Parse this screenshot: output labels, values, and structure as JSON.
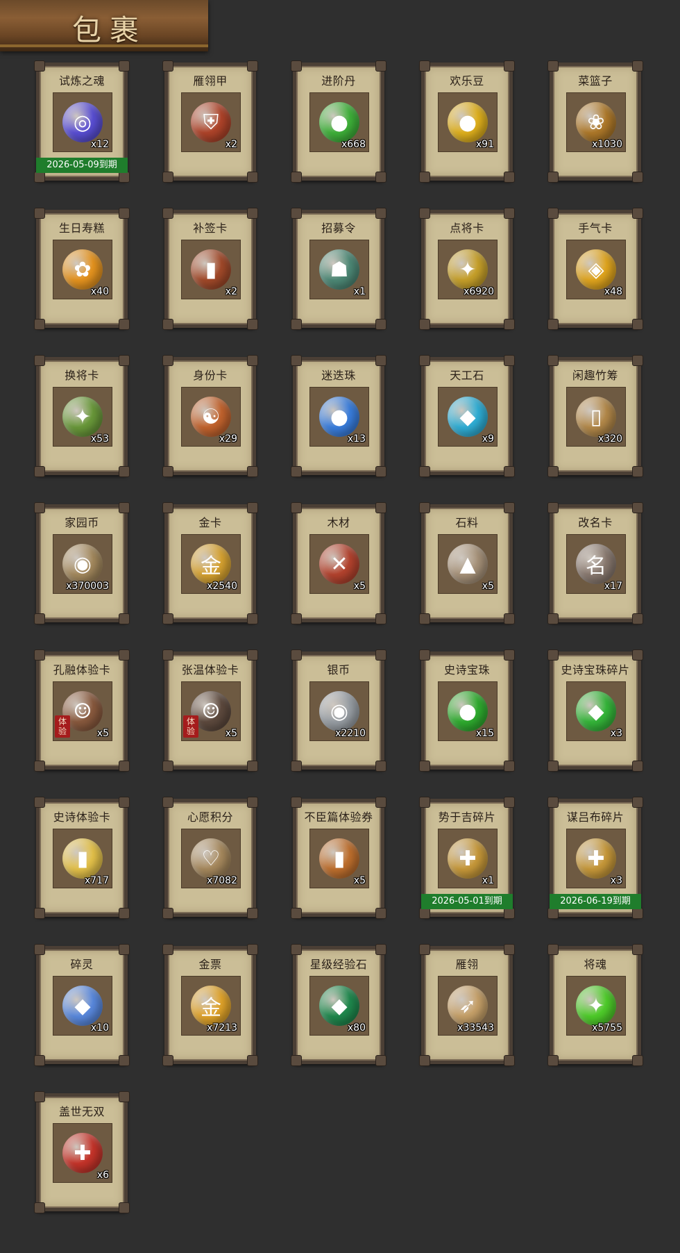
{
  "header": {
    "title": "包裹"
  },
  "items": [
    {
      "name": "试炼之魂",
      "qty": "x12",
      "icon": "dragon-orb-icon",
      "color": "#5a4fd6",
      "glyph": "◎",
      "expiry": "2026-05-09到期"
    },
    {
      "name": "雁翎甲",
      "qty": "x2",
      "icon": "armor-icon",
      "color": "#b0442a",
      "glyph": "⛨",
      "expiry": ""
    },
    {
      "name": "进阶丹",
      "qty": "x668",
      "icon": "pill-icon",
      "color": "#3fb33a",
      "glyph": "●",
      "expiry": ""
    },
    {
      "name": "欢乐豆",
      "qty": "x91",
      "icon": "beans-icon",
      "color": "#e2b21d",
      "glyph": "●",
      "expiry": ""
    },
    {
      "name": "菜篮子",
      "qty": "x1030",
      "icon": "basket-icon",
      "color": "#b07a2a",
      "glyph": "❀",
      "expiry": ""
    },
    {
      "name": "生日寿糕",
      "qty": "x40",
      "icon": "cake-icon",
      "color": "#e8951f",
      "glyph": "✿",
      "expiry": ""
    },
    {
      "name": "补签卡",
      "qty": "x2",
      "icon": "sign-card-icon",
      "color": "#a34a2a",
      "glyph": "▮",
      "expiry": ""
    },
    {
      "name": "招募令",
      "qty": "x1",
      "icon": "recruit-token-icon",
      "color": "#4e8a77",
      "glyph": "☗",
      "expiry": ""
    },
    {
      "name": "点将卡",
      "qty": "x6920",
      "icon": "general-card-icon",
      "color": "#c9a22a",
      "glyph": "✦",
      "expiry": ""
    },
    {
      "name": "手气卡",
      "qty": "x48",
      "icon": "luck-card-icon",
      "color": "#e3a71e",
      "glyph": "◈",
      "expiry": ""
    },
    {
      "name": "换将卡",
      "qty": "x53",
      "icon": "swap-card-icon",
      "color": "#6a9a3a",
      "glyph": "✦",
      "expiry": ""
    },
    {
      "name": "身份卡",
      "qty": "x29",
      "icon": "identity-card-icon",
      "color": "#c4642e",
      "glyph": "☯",
      "expiry": ""
    },
    {
      "name": "迷迭珠",
      "qty": "x13",
      "icon": "blue-orb-icon",
      "color": "#3a7fe0",
      "glyph": "●",
      "expiry": ""
    },
    {
      "name": "天工石",
      "qty": "x9",
      "icon": "crystal-icon",
      "color": "#2fb0d8",
      "glyph": "◆",
      "expiry": ""
    },
    {
      "name": "闲趣竹筹",
      "qty": "x320",
      "icon": "bamboo-token-icon",
      "color": "#b58a4a",
      "glyph": "▯",
      "expiry": ""
    },
    {
      "name": "家园币",
      "qty": "x370003",
      "icon": "home-coin-icon",
      "color": "#a58a5e",
      "glyph": "◉",
      "expiry": ""
    },
    {
      "name": "金卡",
      "qty": "x2540",
      "icon": "gold-card-icon",
      "color": "#d9a431",
      "glyph": "金",
      "expiry": ""
    },
    {
      "name": "木材",
      "qty": "x5",
      "icon": "wood-icon",
      "color": "#b5432e",
      "glyph": "✕",
      "expiry": ""
    },
    {
      "name": "石料",
      "qty": "x5",
      "icon": "stone-icon",
      "color": "#a8937a",
      "glyph": "▲",
      "expiry": ""
    },
    {
      "name": "改名卡",
      "qty": "x17",
      "icon": "rename-card-icon",
      "color": "#8a7a70",
      "glyph": "名",
      "expiry": ""
    },
    {
      "name": "孔融体验卡",
      "qty": "x5",
      "icon": "kongrong-portrait-icon",
      "color": "#8a5a3e",
      "glyph": "☺",
      "expiry": "",
      "trial": "体验"
    },
    {
      "name": "张温体验卡",
      "qty": "x5",
      "icon": "zhangwen-portrait-icon",
      "color": "#5e4a3e",
      "glyph": "☺",
      "expiry": "",
      "trial": "体验"
    },
    {
      "name": "银币",
      "qty": "x2210",
      "icon": "silver-coin-icon",
      "color": "#9aa0a6",
      "glyph": "◉",
      "expiry": ""
    },
    {
      "name": "史诗宝珠",
      "qty": "x15",
      "icon": "green-orb-icon",
      "color": "#2fae2f",
      "glyph": "●",
      "expiry": ""
    },
    {
      "name": "史诗宝珠碎片",
      "qty": "x3",
      "icon": "orb-shard-icon",
      "color": "#35b83a",
      "glyph": "◆",
      "expiry": ""
    },
    {
      "name": "史诗体验卡",
      "qty": "x717",
      "icon": "epic-trial-card-icon",
      "color": "#e6c34a",
      "glyph": "▮",
      "expiry": ""
    },
    {
      "name": "心愿积分",
      "qty": "x7082",
      "icon": "wish-coin-icon",
      "color": "#a88a5e",
      "glyph": "♡",
      "expiry": ""
    },
    {
      "name": "不臣篇体验券",
      "qty": "x5",
      "icon": "trial-ticket-icon",
      "color": "#c0702e",
      "glyph": "▮",
      "expiry": ""
    },
    {
      "name": "势于吉碎片",
      "qty": "x1",
      "icon": "puzzle-shard-icon",
      "color": "#c99a3a",
      "glyph": "✚",
      "expiry": "2026-05-01到期"
    },
    {
      "name": "谋吕布碎片",
      "qty": "x3",
      "icon": "puzzle-shard-icon",
      "color": "#c99a3a",
      "glyph": "✚",
      "expiry": "2026-06-19到期"
    },
    {
      "name": "碎灵",
      "qty": "x10",
      "icon": "crystal-shard-icon",
      "color": "#5a8ae0",
      "glyph": "◆",
      "expiry": ""
    },
    {
      "name": "金票",
      "qty": "x7213",
      "icon": "gold-ticket-icon",
      "color": "#e3a52a",
      "glyph": "金",
      "expiry": ""
    },
    {
      "name": "星级经验石",
      "qty": "x80",
      "icon": "jade-stone-icon",
      "color": "#1f8a4e",
      "glyph": "◆",
      "expiry": ""
    },
    {
      "name": "雁翎",
      "qty": "x33543",
      "icon": "feather-icon",
      "color": "#c8a26a",
      "glyph": "➶",
      "expiry": ""
    },
    {
      "name": "将魂",
      "qty": "x5755",
      "icon": "soul-crystal-icon",
      "color": "#4fcf2a",
      "glyph": "✦",
      "expiry": ""
    },
    {
      "name": "盖世无双",
      "qty": "x6",
      "icon": "gift-box-icon",
      "color": "#c7342a",
      "glyph": "✚",
      "expiry": ""
    }
  ]
}
